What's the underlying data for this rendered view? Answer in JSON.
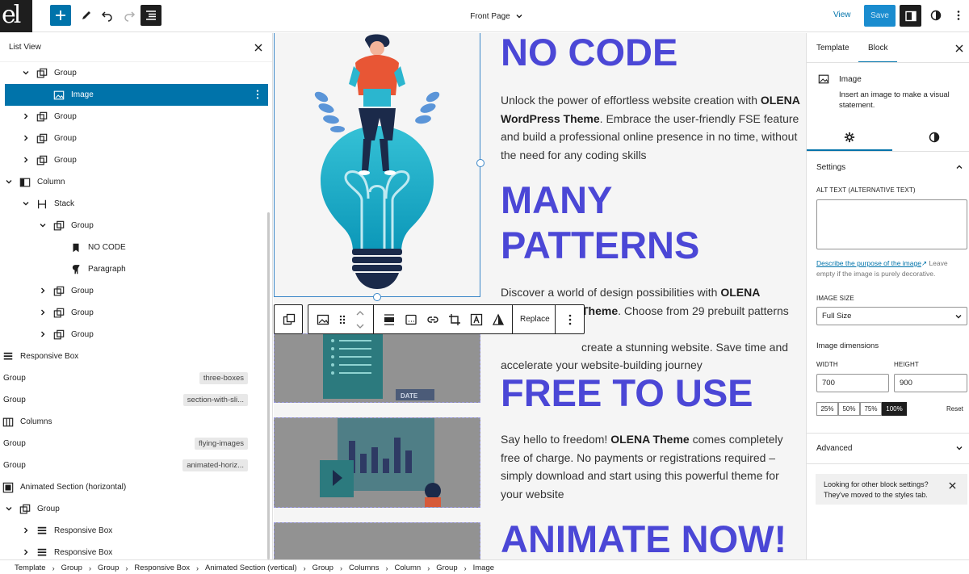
{
  "topbar": {
    "logo_text": "el",
    "doc_title": "Front Page",
    "view_label": "View",
    "save_label": "Save"
  },
  "list_view": {
    "title": "List View",
    "rows": [
      {
        "label": "Group",
        "icon": "group-icon",
        "expanded": true
      },
      {
        "label": "Image",
        "icon": "image-icon",
        "selected": true
      },
      {
        "label": "Group",
        "icon": "group-icon",
        "expanded": false
      },
      {
        "label": "Group",
        "icon": "group-icon",
        "expanded": false
      },
      {
        "label": "Group",
        "icon": "group-icon",
        "expanded": false
      },
      {
        "label": "Column",
        "icon": "column-icon",
        "expanded": true
      },
      {
        "label": "Stack",
        "icon": "stack-icon",
        "expanded": true
      },
      {
        "label": "Group",
        "icon": "group-icon",
        "expanded": true
      },
      {
        "label": "NO CODE",
        "icon": "bookmark-icon"
      },
      {
        "label": "Paragraph",
        "icon": "paragraph-icon"
      },
      {
        "label": "Group",
        "icon": "group-icon",
        "expanded": false
      },
      {
        "label": "Group",
        "icon": "group-icon",
        "expanded": false
      },
      {
        "label": "Group",
        "icon": "group-icon",
        "expanded": false
      },
      {
        "label": "Responsive Box",
        "icon": "responsive-box-icon",
        "expanded": false
      },
      {
        "label": "Group",
        "icon": "group-icon",
        "expanded": false,
        "anchor": "three-boxes"
      },
      {
        "label": "Group",
        "icon": "group-icon",
        "expanded": true,
        "anchor": "section-with-sli..."
      },
      {
        "label": "Columns",
        "icon": "columns-icon",
        "expanded": false
      },
      {
        "label": "Group",
        "icon": "group-icon",
        "expanded": false,
        "anchor": "flying-images"
      },
      {
        "label": "Group",
        "icon": "group-icon",
        "expanded": true,
        "anchor": "animated-horiz..."
      },
      {
        "label": "Animated Section (horizontal)",
        "icon": "animated-section-icon",
        "expanded": true
      },
      {
        "label": "Group",
        "icon": "group-icon",
        "expanded": true
      },
      {
        "label": "Responsive Box",
        "icon": "responsive-box-icon",
        "expanded": false
      },
      {
        "label": "Responsive Box",
        "icon": "responsive-box-icon",
        "expanded": false
      }
    ]
  },
  "canvas": {
    "headings": [
      "NO CODE",
      "MANY",
      "PATTERNS",
      "FREE TO USE",
      "ANIMATE NOW!"
    ],
    "p1": {
      "a": "Unlock the power of effortless website creation with ",
      "b1": "OLENA",
      "c": "WordPress Theme",
      "d": ". Embrace the user-friendly FSE feature and build a professional online presence in no time, without the need for any coding skills"
    },
    "p2": {
      "a": "Discover a world of design possibilities with ",
      "b": "OLENA",
      "c": "Theme",
      "d": ". Choose from 29 prebuilt patterns to",
      "e": "create a stunning website. Save time and",
      "f": "accelerate your website-building journey"
    },
    "p3": {
      "a": "Say hello to freedom! ",
      "b": "OLENA Theme",
      "c": " comes completely free of charge. No payments or registrations required – simply download and start using this powerful theme for your website"
    },
    "date_label": "DATE"
  },
  "block_toolbar": {
    "replace_label": "Replace"
  },
  "sidebar": {
    "tab_template": "Template",
    "tab_block": "Block",
    "block_name": "Image",
    "block_desc": "Insert an image to make a visual statement.",
    "settings_title": "Settings",
    "alt_label": "ALT TEXT (ALTERNATIVE TEXT)",
    "alt_value": "",
    "alt_link": "Describe the purpose of the image",
    "alt_help": "Leave empty if the image is purely decorative.",
    "size_label": "IMAGE SIZE",
    "size_value": "Full Size",
    "dims_label": "Image dimensions",
    "width_label": "WIDTH",
    "height_label": "HEIGHT",
    "width_value": "700",
    "height_value": "900",
    "percents": [
      "25%",
      "50%",
      "75%",
      "100%"
    ],
    "percent_selected": "100%",
    "reset_label": "Reset",
    "advanced_title": "Advanced",
    "notice": "Looking for other block settings? They've moved to the styles tab."
  },
  "breadcrumbs": [
    "Template",
    "Group",
    "Group",
    "Responsive Box",
    "Animated Section (vertical)",
    "Group",
    "Columns",
    "Column",
    "Group",
    "Image"
  ],
  "colors": {
    "accent": "#0073aa",
    "heading": "#4b47d6",
    "save": "#1a8ccf"
  }
}
